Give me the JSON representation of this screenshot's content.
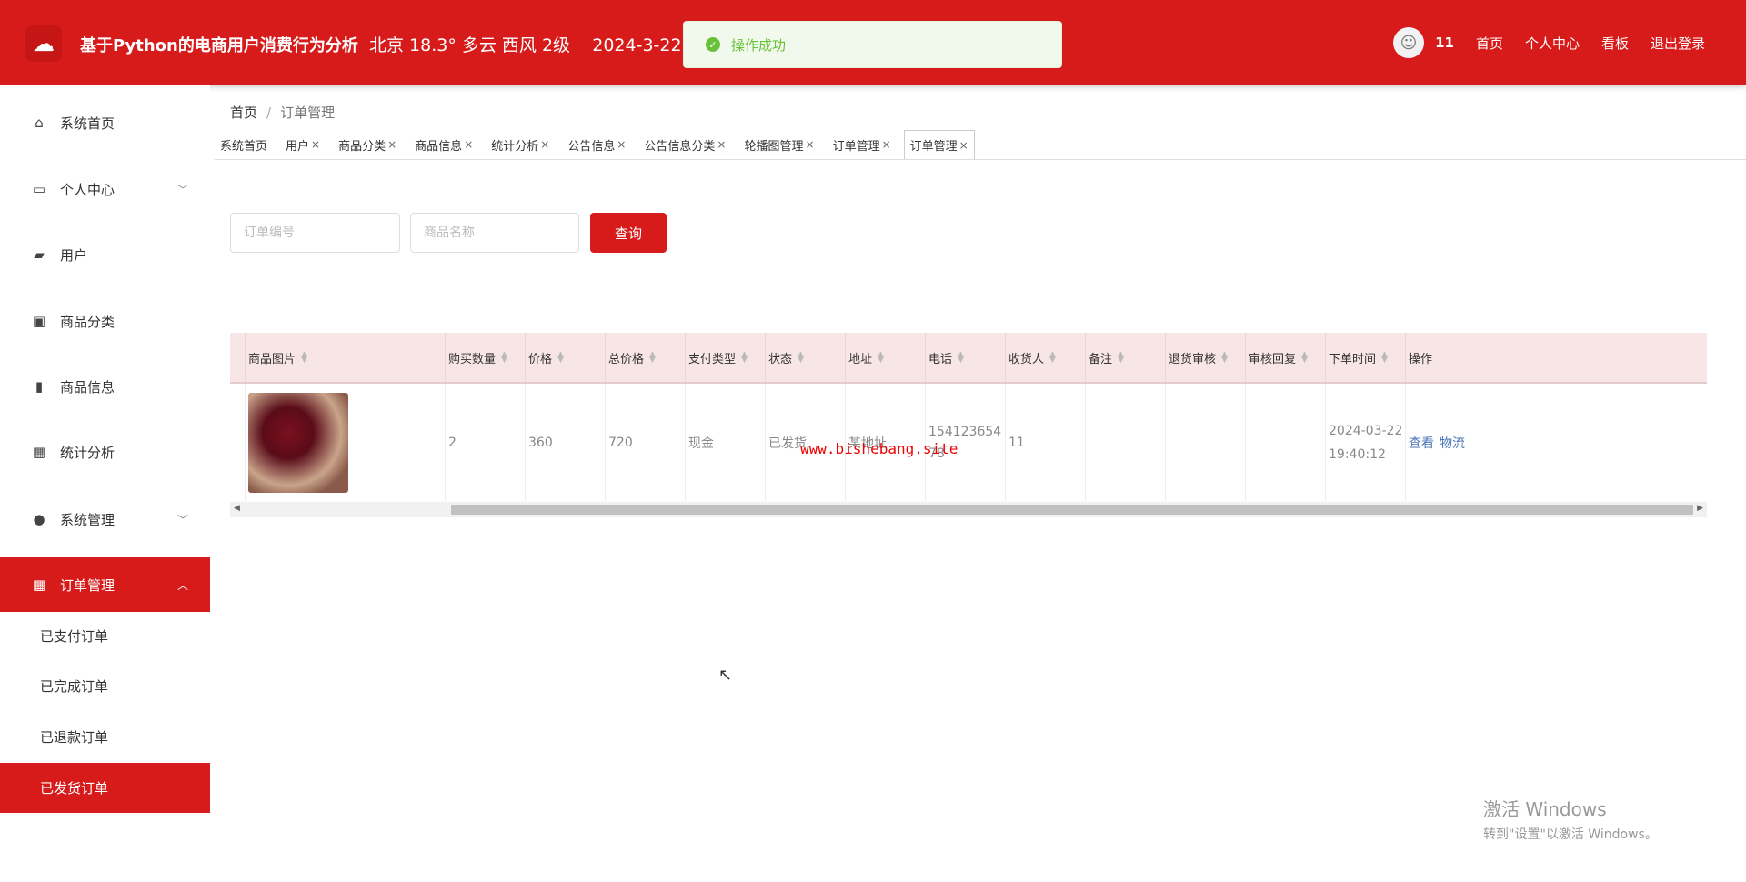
{
  "header": {
    "title": "基于Python的电商用户消费行为分析",
    "weather": "北京 18.3° 多云 西风 2级",
    "date": "2024-3-22 1",
    "user": "11",
    "nav": [
      "首页",
      "个人中心",
      "看板",
      "退出登录"
    ]
  },
  "toast": {
    "message": "操作成功"
  },
  "sidebar": {
    "items": [
      "系统首页",
      "个人中心",
      "用户",
      "商品分类",
      "商品信息",
      "统计分析",
      "系统管理",
      "订单管理"
    ],
    "subitems": [
      "已支付订单",
      "已完成订单",
      "已退款订单",
      "已发货订单"
    ]
  },
  "breadcrumb": {
    "home": "首页",
    "current": "订单管理"
  },
  "tabs": [
    "系统首页",
    "用户",
    "商品分类",
    "商品信息",
    "统计分析",
    "公告信息",
    "公告信息分类",
    "轮播图管理",
    "订单管理",
    "订单管理"
  ],
  "search": {
    "order_placeholder": "订单编号",
    "product_placeholder": "商品名称",
    "button": "查询"
  },
  "table": {
    "headers": [
      "商品图片",
      "购买数量",
      "价格",
      "总价格",
      "支付类型",
      "状态",
      "地址",
      "电话",
      "收货人",
      "备注",
      "退货审核",
      "审核回复",
      "下单时间",
      "操作"
    ],
    "rows": [
      {
        "qty": "2",
        "price": "360",
        "total": "720",
        "pay": "现金",
        "status": "已发货",
        "address": "某地址",
        "phone": "15412365478",
        "receiver": "11",
        "note": "",
        "return_review": "",
        "reply": "",
        "time": "2024-03-22 19:40:12",
        "view": "查看",
        "logistics": "物流"
      }
    ]
  },
  "watermark": "www.bishebang.site",
  "windows": {
    "line1": "激活 Windows",
    "line2": "转到\"设置\"以激活 Windows。"
  }
}
